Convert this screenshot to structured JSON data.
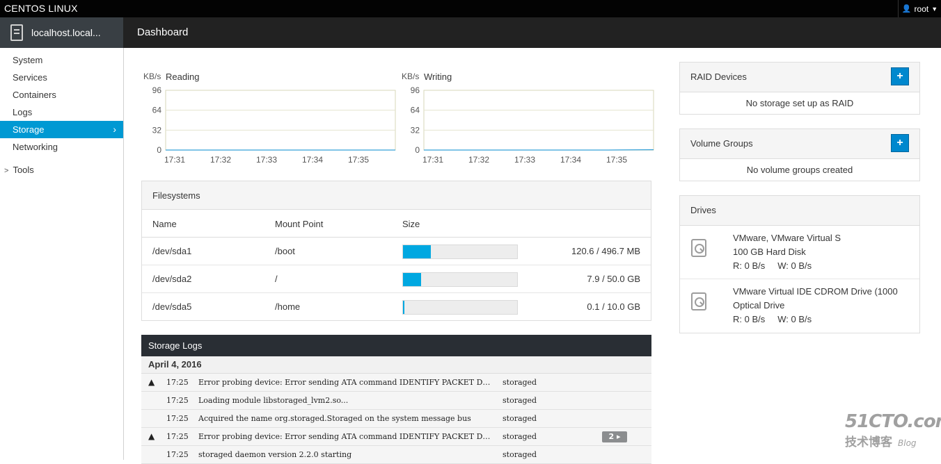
{
  "topbar": {
    "brand": "CENTOS LINUX",
    "user": "root",
    "user_icon": "user-icon"
  },
  "host": {
    "name": "localhost.local...",
    "icon": "server-icon"
  },
  "page_title": "Dashboard",
  "sidebar": {
    "items": [
      {
        "label": "System",
        "active": false
      },
      {
        "label": "Services",
        "active": false
      },
      {
        "label": "Containers",
        "active": false
      },
      {
        "label": "Logs",
        "active": false
      },
      {
        "label": "Storage",
        "active": true
      },
      {
        "label": "Networking",
        "active": false
      }
    ],
    "tools_label": "Tools"
  },
  "charts": {
    "reading": {
      "title": "Reading",
      "unit": "KB/s"
    },
    "writing": {
      "title": "Writing",
      "unit": "KB/s"
    }
  },
  "chart_data": [
    {
      "type": "line",
      "title": "Reading",
      "ylabel": "KB/s",
      "ylim": [
        0,
        96
      ],
      "yticks": [
        "96",
        "64",
        "32",
        "0"
      ],
      "xticks": [
        "17:31",
        "17:32",
        "17:33",
        "17:34",
        "17:35"
      ],
      "series": [
        {
          "values": [
            0,
            0,
            0,
            0,
            0,
            0
          ]
        }
      ],
      "grid": true
    },
    {
      "type": "line",
      "title": "Writing",
      "ylabel": "KB/s",
      "ylim": [
        0,
        96
      ],
      "yticks": [
        "96",
        "64",
        "32",
        "0"
      ],
      "xticks": [
        "17:31",
        "17:32",
        "17:33",
        "17:34",
        "17:35"
      ],
      "series": [
        {
          "values": [
            0,
            0,
            0,
            0,
            0,
            0.5
          ]
        }
      ],
      "grid": true
    }
  ],
  "filesystems": {
    "title": "Filesystems",
    "columns": {
      "name": "Name",
      "mount": "Mount Point",
      "size": "Size"
    },
    "rows": [
      {
        "name": "/dev/sda1",
        "mount": "/boot",
        "usage": 0.243,
        "size": "120.6 / 496.7 MB"
      },
      {
        "name": "/dev/sda2",
        "mount": "/",
        "usage": 0.158,
        "size": "7.9 / 50.0 GB"
      },
      {
        "name": "/dev/sda5",
        "mount": "/home",
        "usage": 0.01,
        "size": "0.1 / 10.0 GB"
      }
    ]
  },
  "logs": {
    "title": "Storage Logs",
    "date": "April 4, 2016",
    "entries": [
      {
        "warn": true,
        "time": "17:25",
        "message": "Error probing device: Error sending ATA command IDENTIFY PACKET DEV…",
        "source": "storaged",
        "count": ""
      },
      {
        "warn": false,
        "time": "17:25",
        "message": "Loading module libstoraged_lvm2.so...",
        "source": "storaged",
        "count": ""
      },
      {
        "warn": false,
        "time": "17:25",
        "message": "Acquired the name org.storaged.Storaged on the system message bus",
        "source": "storaged",
        "count": ""
      },
      {
        "warn": true,
        "time": "17:25",
        "message": "Error probing device: Error sending ATA command IDENTIFY PACKET DEV…",
        "source": "storaged",
        "count": "2 ▸"
      },
      {
        "warn": false,
        "time": "17:25",
        "message": "storaged daemon version 2.2.0 starting",
        "source": "storaged",
        "count": ""
      }
    ]
  },
  "raid": {
    "title": "RAID Devices",
    "add": "+",
    "empty": "No storage set up as RAID"
  },
  "volume_groups": {
    "title": "Volume Groups",
    "add": "+",
    "empty": "No volume groups created"
  },
  "drives": {
    "title": "Drives",
    "items": [
      {
        "name": "VMware, VMware Virtual S",
        "desc": "100 GB Hard Disk",
        "read": "R: 0 B/s",
        "write": "W: 0 B/s"
      },
      {
        "name": "VMware Virtual IDE CDROM Drive (1000",
        "desc": "Optical Drive",
        "read": "R: 0 B/s",
        "write": "W: 0 B/s"
      }
    ]
  },
  "watermark": {
    "line1": "51CTO.com",
    "line2": "技术博客",
    "line3": "Blog"
  }
}
